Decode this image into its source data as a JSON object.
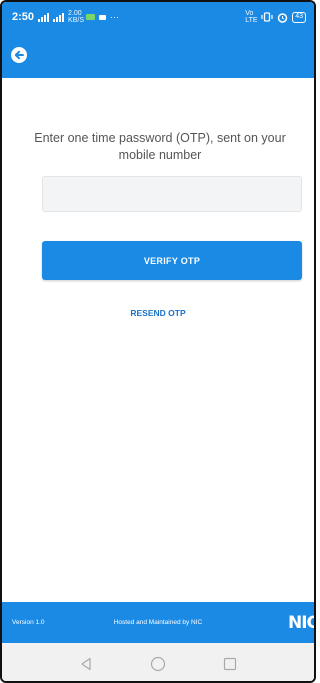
{
  "status_bar": {
    "time": "2:50",
    "speed": "2.00 KB/S",
    "more": "···",
    "volte": "Vo LTE",
    "battery": "43"
  },
  "app_bar": {
    "back_icon": "arrow-left-circle-icon"
  },
  "otp": {
    "prompt": "Enter one time password (OTP), sent on your mobile number",
    "input_value": "",
    "input_placeholder": "",
    "verify_label": "VERIFY OTP",
    "resend_label": "RESEND OTP"
  },
  "footer": {
    "version": "Version 1.0",
    "hosted": "Hosted and Maintained by NIC",
    "logo": "NIC"
  },
  "nav_bar": {
    "icons": [
      "back-triangle-icon",
      "home-circle-icon",
      "recents-square-icon"
    ]
  },
  "colors": {
    "primary": "#1a8ae5",
    "link": "#1a73c9",
    "input_bg": "#f2f4f6"
  }
}
